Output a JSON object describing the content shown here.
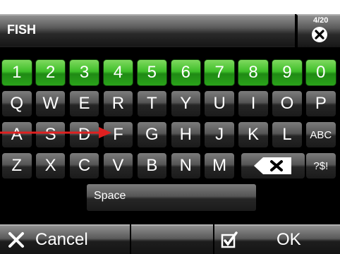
{
  "input": {
    "value": "FISH",
    "counter": "4/20",
    "clear_icon": "clear-circle-x-icon"
  },
  "keyboard": {
    "numbers": [
      "1",
      "2",
      "3",
      "4",
      "5",
      "6",
      "7",
      "8",
      "9",
      "0"
    ],
    "row1": [
      "Q",
      "W",
      "E",
      "R",
      "T",
      "Y",
      "U",
      "I",
      "O",
      "P"
    ],
    "row2": [
      "A",
      "S",
      "D",
      "F",
      "G",
      "H",
      "J",
      "K",
      "L",
      "ABC"
    ],
    "row3": [
      "Z",
      "X",
      "C",
      "V",
      "B",
      "N",
      "M"
    ],
    "backspace_icon": "backspace-icon",
    "symbols_label": "?$!",
    "space_label": "Space"
  },
  "footer": {
    "cancel_label": "Cancel",
    "ok_label": "OK",
    "cancel_icon": "x-icon",
    "ok_icon": "checkbox-check-icon"
  },
  "colors": {
    "number_key": "#3fbf2a",
    "letter_key": "#555555",
    "annotation_arrow": "#e02020"
  }
}
